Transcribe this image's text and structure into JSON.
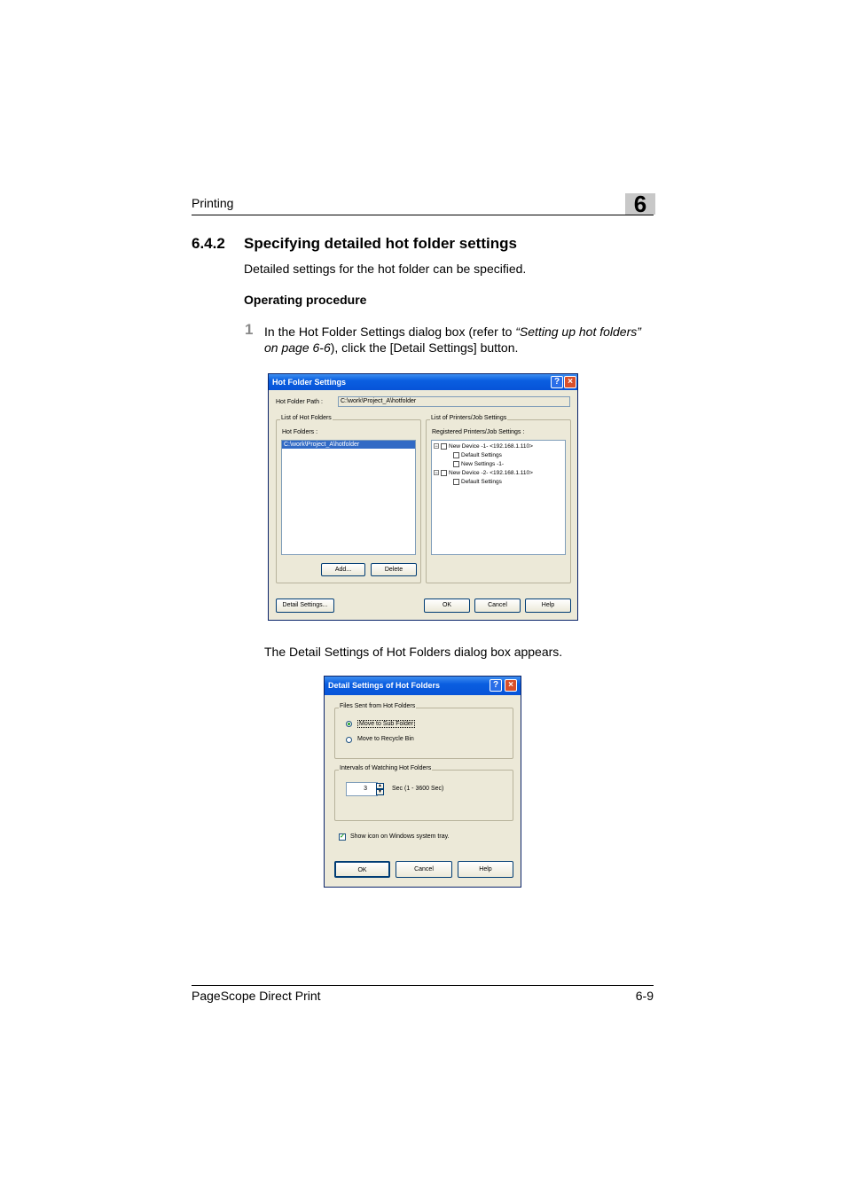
{
  "header": {
    "section": "Printing",
    "chapter": "6"
  },
  "section": {
    "number": "6.4.2",
    "title": "Specifying detailed hot folder settings"
  },
  "intro": "Detailed settings for the hot folder can be specified.",
  "procedure_heading": "Operating procedure",
  "step1": {
    "number": "1",
    "text_a": "In the Hot Folder Settings dialog box (refer to ",
    "text_ref": "“Setting up hot folders” on page 6-6",
    "text_b": "), click the [Detail Settings] button."
  },
  "after_text": "The Detail Settings of Hot Folders dialog box appears.",
  "dialog1": {
    "title": "Hot Folder Settings",
    "path_label": "Hot Folder Path :",
    "path_value": "C:\\work\\Project_A\\hotfolder",
    "list_group": "List of Hot Folders",
    "hot_folders_label": "Hot Folders :",
    "hot_folders": [
      "C:\\work\\Project_A\\hotfolder"
    ],
    "printers_group": "List of Printers/Job Settings",
    "registered_label": "Registered Printers/Job Settings :",
    "tree": [
      {
        "label": "New Device -1- <192.168.1.110>"
      },
      {
        "label": "Default Settings"
      },
      {
        "label": "New Settings -1-"
      },
      {
        "label": "New Device -2- <192.168.1.110>"
      },
      {
        "label": "Default Settings"
      }
    ],
    "add_button": "Add...",
    "delete_button": "Delete",
    "detail_button": "Detail Settings...",
    "ok_button": "OK",
    "cancel_button": "Cancel",
    "help_button": "Help"
  },
  "dialog2": {
    "title": "Detail Settings of Hot Folders",
    "files_group": "Files Sent from Hot Folders",
    "radio_move_sub": "Move to Sub Folder",
    "radio_recycle": "Move to Recycle Bin",
    "interval_group": "Intervals of Watching Hot Folders",
    "interval_value": "3",
    "interval_unit": "Sec (1 - 3600 Sec)",
    "show_icon": "Show icon on Windows system tray.",
    "ok_button": "OK",
    "cancel_button": "Cancel",
    "help_button": "Help"
  },
  "footer": {
    "left": "PageScope Direct Print",
    "right": "6-9"
  }
}
